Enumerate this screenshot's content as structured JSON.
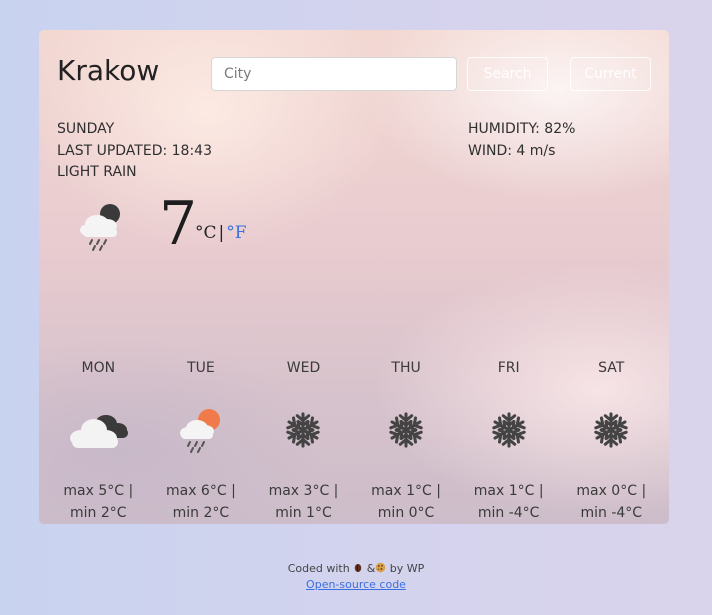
{
  "header": {
    "city": "Krakow",
    "search_placeholder": "City",
    "search_label": "Search",
    "current_label": "Current"
  },
  "current": {
    "day": "SUNDAY",
    "updated": "LAST UPDATED: 18:43",
    "description": "LIGHT RAIN",
    "humidity": "HUMIDITY: 82%",
    "wind": "WIND: 4 m/s",
    "temperature": "7",
    "unit_c": "°C",
    "unit_sep": "|",
    "unit_f": "°F",
    "icon": "cloud-night-rain-icon"
  },
  "forecast": [
    {
      "day": "MON",
      "max": "max 5°C |",
      "min": "min 2°C",
      "icon": "cloudy-icon"
    },
    {
      "day": "TUE",
      "max": "max 6°C |",
      "min": "min 2°C",
      "icon": "sun-cloud-rain-icon"
    },
    {
      "day": "WED",
      "max": "max 3°C |",
      "min": "min 1°C",
      "icon": "snowflake-icon"
    },
    {
      "day": "THU",
      "max": "max 1°C |",
      "min": "min 0°C",
      "icon": "snowflake-icon"
    },
    {
      "day": "FRI",
      "max": "max 1°C |",
      "min": "min -4°C",
      "icon": "snowflake-icon"
    },
    {
      "day": "SAT",
      "max": "max 0°C |",
      "min": "min -4°C",
      "icon": "snowflake-icon"
    }
  ],
  "footer": {
    "credit_prefix": "Coded with",
    "credit_amp": "&",
    "credit_suffix": "by WP",
    "link": "Open-source code"
  },
  "colors": {
    "accent": "#3b6fe0",
    "sun": "#f07a4a"
  }
}
